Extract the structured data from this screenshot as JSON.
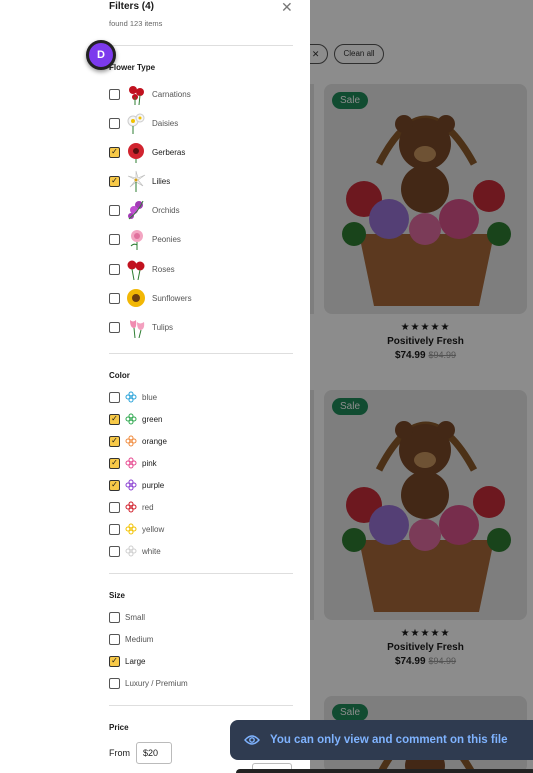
{
  "filters": {
    "title": "Filters (4)",
    "found": "found 123 items",
    "flower_type": {
      "title": "Flower Type",
      "options": [
        {
          "label": "Carnations",
          "checked": false,
          "icon": "carnation-icon"
        },
        {
          "label": "Daisies",
          "checked": false,
          "icon": "daisy-icon"
        },
        {
          "label": "Gerberas",
          "checked": true,
          "icon": "gerbera-icon"
        },
        {
          "label": "Lilies",
          "checked": true,
          "icon": "lily-icon"
        },
        {
          "label": "Orchids",
          "checked": false,
          "icon": "orchid-icon"
        },
        {
          "label": "Peonies",
          "checked": false,
          "icon": "peony-icon"
        },
        {
          "label": "Roses",
          "checked": false,
          "icon": "rose-icon"
        },
        {
          "label": "Sunflowers",
          "checked": false,
          "icon": "sunflower-icon"
        },
        {
          "label": "Tulips",
          "checked": false,
          "icon": "tulip-icon"
        }
      ]
    },
    "color": {
      "title": "Color",
      "options": [
        {
          "label": "blue",
          "checked": false,
          "hex": "#2aa3d9"
        },
        {
          "label": "green",
          "checked": true,
          "hex": "#2fa84f"
        },
        {
          "label": "orange",
          "checked": true,
          "hex": "#f08a3c"
        },
        {
          "label": "pink",
          "checked": true,
          "hex": "#e6488f"
        },
        {
          "label": "purple",
          "checked": true,
          "hex": "#8a3fd1"
        },
        {
          "label": "red",
          "checked": false,
          "hex": "#d01e2a"
        },
        {
          "label": "yellow",
          "checked": false,
          "hex": "#f2c200"
        },
        {
          "label": "white",
          "checked": false,
          "hex": "#cfcfcf"
        }
      ]
    },
    "size": {
      "title": "Size",
      "options": [
        {
          "label": "Small",
          "checked": false
        },
        {
          "label": "Medium",
          "checked": false
        },
        {
          "label": "Large",
          "checked": true
        },
        {
          "label": "Luxury / Premium",
          "checked": false
        }
      ]
    },
    "price": {
      "title": "Price",
      "from_label": "From",
      "from_value": "$20"
    }
  },
  "chips": [
    {
      "label": "ge"
    },
    {
      "label": "Clean all"
    }
  ],
  "products": [
    {
      "badge": "Sale",
      "stars": "★★★★★",
      "name": "Positively Fresh",
      "price": "$74.99",
      "was": "$94.99"
    },
    {
      "badge": "Sale",
      "stars": "★★★★★",
      "name": "Positively Fresh",
      "price": "$74.99",
      "was": "$94.99"
    },
    {
      "badge": "Sale"
    }
  ],
  "avatar": {
    "initial": "D"
  },
  "toast": {
    "text": "You can only view and comment on this file"
  },
  "colors": {
    "checkbox_on": "#f7c948",
    "sale_badge": "#1f8a5a",
    "toast_bg": "#2f3b50",
    "toast_text": "#7fb3ff",
    "avatar": "#7c3aed"
  }
}
